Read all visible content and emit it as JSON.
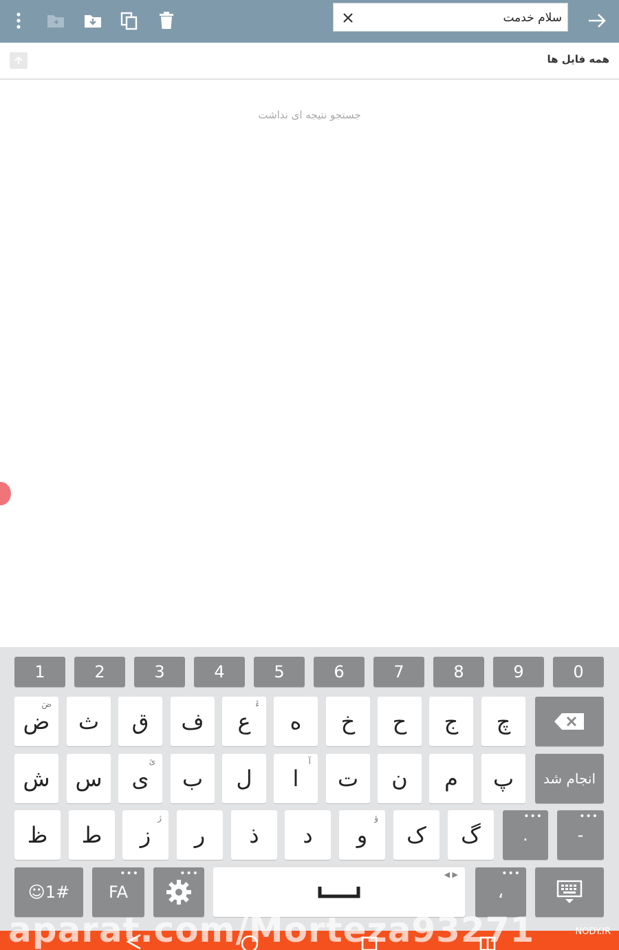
{
  "toolbar": {
    "search_value": "سلام خدمت",
    "icons": [
      "more-vert-icon",
      "new-folder-icon",
      "download-icon",
      "copy-icon",
      "delete-icon",
      "clear-icon",
      "arrow-forward-icon"
    ]
  },
  "pathbar": {
    "title": "همه فایل ها"
  },
  "results": {
    "empty_message": "جستجو نتیجه ای نداشت"
  },
  "keyboard": {
    "number_row": [
      "1",
      "2",
      "3",
      "4",
      "5",
      "6",
      "7",
      "8",
      "9",
      "0"
    ],
    "row1": [
      "ض",
      "ث",
      "ق",
      "ف",
      "ع",
      "ه",
      "خ",
      "ح",
      "ج",
      "چ"
    ],
    "row1_hints": [
      "ضَ",
      "",
      "",
      "",
      "ءٔ",
      "",
      "",
      "",
      "",
      ""
    ],
    "row2": [
      "ش",
      "س",
      "ی",
      "ب",
      "ل",
      "ا",
      "ت",
      "ن",
      "م",
      "پ"
    ],
    "row2_hints": [
      "",
      "",
      "ئ",
      "",
      "",
      "آ",
      "",
      "",
      "",
      ""
    ],
    "row3": [
      "ظ",
      "ط",
      "ز",
      "ر",
      "ذ",
      "د",
      "و",
      "ک",
      "گ"
    ],
    "row3_hints": [
      "",
      "",
      "ژ",
      "",
      "",
      "",
      "ؤ",
      "",
      ""
    ],
    "done_label": "انجام شد",
    "row3_extra": [
      ".",
      "-"
    ],
    "emoji_label": "☺1#",
    "lang_label": "FA",
    "comma_label": "،"
  },
  "overlay": {
    "watermark": "aparat.com/Morteza93271",
    "site": "NODY.IR"
  },
  "colors": {
    "toolbar": "#7f9aab",
    "key_func": "#8a8c8e",
    "keyboard_bg": "#e2e3e5",
    "nav_orange": "#f4511e"
  }
}
